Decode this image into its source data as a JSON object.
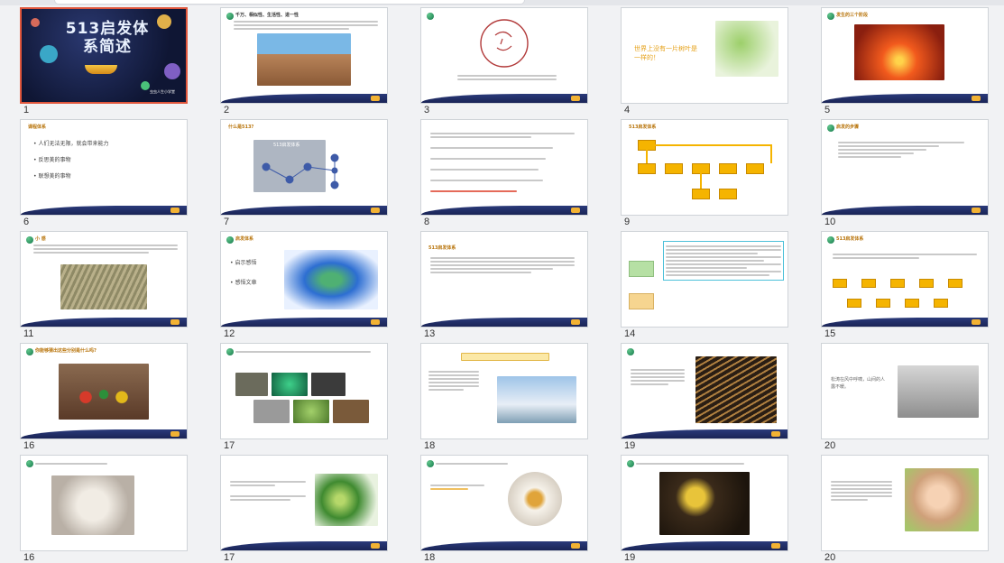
{
  "slides": [
    {
      "num": "1",
      "title": "513启发体系简述",
      "subtitle": "虫虫人生小学堂"
    },
    {
      "num": "2",
      "heading": "千万、相似性、生活性、进一性"
    },
    {
      "num": "3"
    },
    {
      "num": "4",
      "text": "世界上没有一片树叶是一样的！"
    },
    {
      "num": "5",
      "heading": "发生的三个阶段"
    },
    {
      "num": "6",
      "heading": "课程体系",
      "bullets": [
        "人们无法无限，就会带来能力",
        "反思美的事物",
        "联想美的事物"
      ]
    },
    {
      "num": "7",
      "heading": "什么是513?",
      "diagram_title": "513启发体系"
    },
    {
      "num": "8"
    },
    {
      "num": "9",
      "heading": "513启发体系"
    },
    {
      "num": "10",
      "heading": "启发的步骤"
    },
    {
      "num": "11",
      "heading": "小 感"
    },
    {
      "num": "12",
      "heading": "启发体系",
      "bullets": [
        "启示感悟",
        "感悟文章"
      ]
    },
    {
      "num": "13",
      "heading": "513启发体系"
    },
    {
      "num": "14"
    },
    {
      "num": "15",
      "heading": "513启发体系"
    },
    {
      "num": "16",
      "heading": "你能够猜出这些分别是什么吗?"
    },
    {
      "num": "17"
    },
    {
      "num": "18"
    },
    {
      "num": "19"
    },
    {
      "num": "20",
      "text": "松涛在风中呼啸，山间的人露不暖。"
    },
    {
      "num": "16b"
    }
  ],
  "grid_labels": [
    "1",
    "2",
    "3",
    "4",
    "5",
    "6",
    "7",
    "8",
    "9",
    "10",
    "11",
    "12",
    "13",
    "14",
    "15",
    "16",
    "17",
    "18",
    "19",
    "20"
  ],
  "row_labels": [
    "16",
    "17",
    "18",
    "19",
    "20"
  ],
  "colors": {
    "accent": "#e0563c",
    "gold": "#f5b400",
    "navy": "#1a2456"
  }
}
